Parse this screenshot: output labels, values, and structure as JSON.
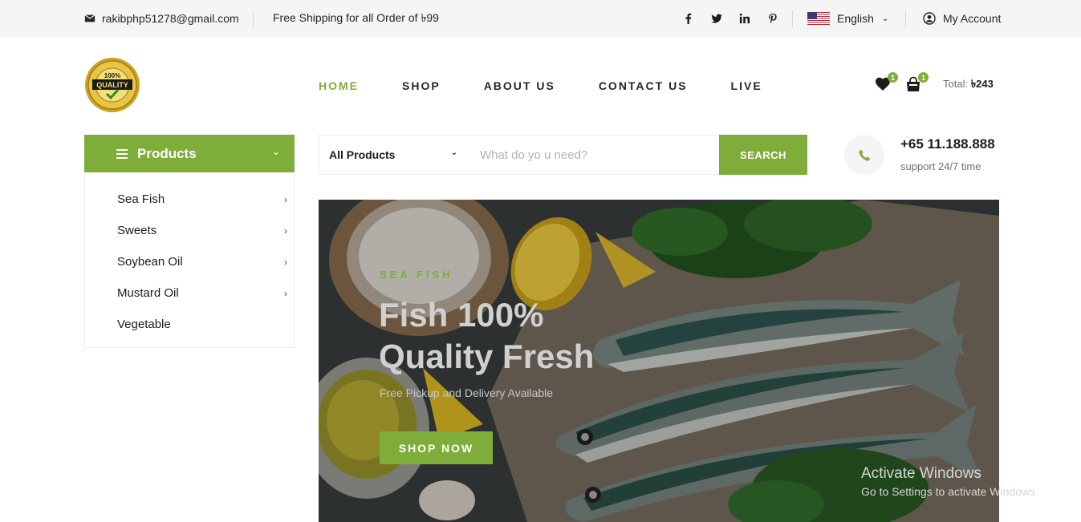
{
  "topbar": {
    "email": "rakibphp51278@gmail.com",
    "shipping": "Free Shipping for all Order of ৳99",
    "social": [
      "f",
      "twitter",
      "in",
      "pinterest"
    ],
    "language": "English",
    "account": "My Account"
  },
  "logo": {
    "line1": "100%",
    "line2": "QUALITY"
  },
  "nav": {
    "items": [
      {
        "label": "HOME",
        "active": true
      },
      {
        "label": "SHOP",
        "active": false
      },
      {
        "label": "ABOUT US",
        "active": false
      },
      {
        "label": "CONTACT US",
        "active": false
      },
      {
        "label": "LIVE",
        "active": false
      }
    ]
  },
  "cart": {
    "wishlist_count": "1",
    "cart_count": "1",
    "total_label": "Total:",
    "total_value": "৳243"
  },
  "categories": {
    "title": "Products",
    "items": [
      {
        "label": "Sea Fish",
        "has_sub": true
      },
      {
        "label": "Sweets",
        "has_sub": true
      },
      {
        "label": "Soybean Oil",
        "has_sub": true
      },
      {
        "label": "Mustard Oil",
        "has_sub": true
      },
      {
        "label": "Vegetable",
        "has_sub": false
      }
    ]
  },
  "search": {
    "category": "All Products",
    "placeholder": "What do yo u need?",
    "button": "SEARCH"
  },
  "contact": {
    "phone": "+65 11.188.888",
    "support": "support 24/7 time"
  },
  "hero": {
    "kicker": "SEA FISH",
    "title_line1": "Fish 100%",
    "title_line2": "Quality Fresh",
    "subtitle": "Free Pickup and Delivery Available",
    "button": "SHOP NOW"
  },
  "watermark": {
    "line1": "Activate Windows",
    "line2": "Go to Settings to activate Windows."
  },
  "colors": {
    "accent": "#7fad39",
    "topbar_bg": "#f5f5f5"
  }
}
